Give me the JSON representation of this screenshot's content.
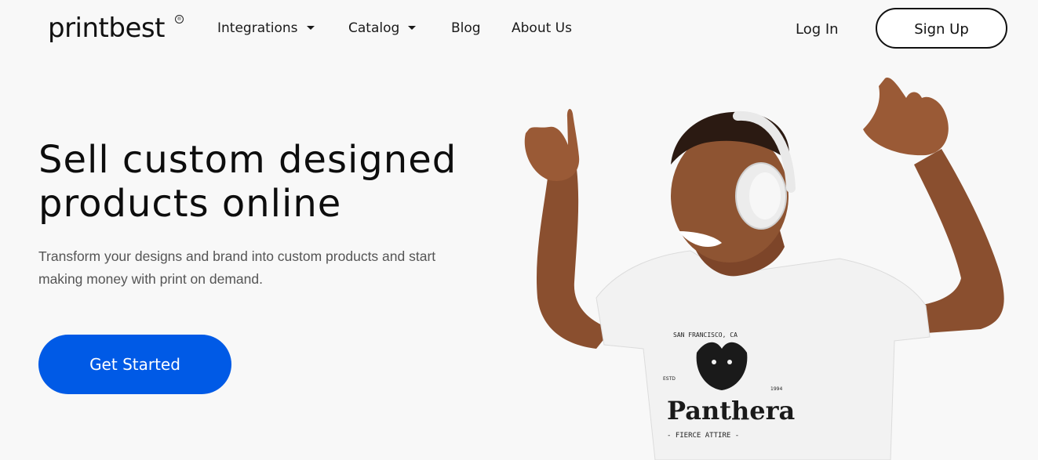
{
  "header": {
    "logo_text": "printbest",
    "logo_mark": "®",
    "nav": [
      {
        "label": "Integrations",
        "dropdown": true
      },
      {
        "label": "Catalog",
        "dropdown": true
      },
      {
        "label": "Blog",
        "dropdown": false
      },
      {
        "label": "About Us",
        "dropdown": false
      }
    ],
    "login_label": "Log In",
    "signup_label": "Sign Up"
  },
  "hero": {
    "title_line1": "Sell custom designed",
    "title_line2": "products online",
    "subtitle_line1": "Transform your designs and brand into custom products and start",
    "subtitle_line2": "making money with print on demand.",
    "cta_label": "Get Started",
    "cta_color": "#005ae6"
  },
  "photo": {
    "shirt_top_text": "SAN FRANCISCO, CA",
    "shirt_brand": "Panthera",
    "shirt_est_left": "ESTD",
    "shirt_est_right": "1994",
    "shirt_bottom_text": "- FIERCE ATTIRE -"
  }
}
